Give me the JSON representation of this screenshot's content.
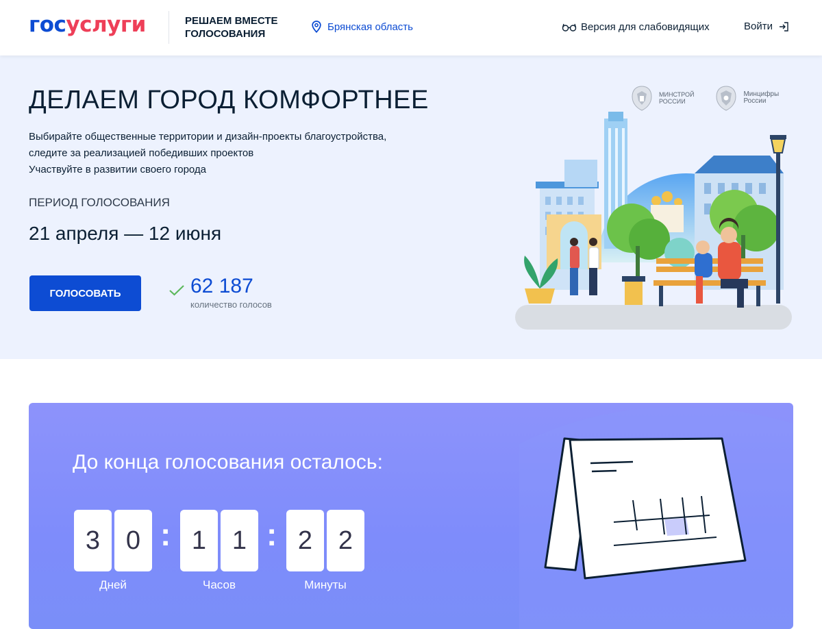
{
  "header": {
    "logo_part1": "гос",
    "logo_part2": "услуги",
    "tagline_line1": "РЕШАЕМ ВМЕСТЕ",
    "tagline_line2": "ГОЛОСОВАНИЯ",
    "region": "Брянская область",
    "vision_link": "Версия для слабовидящих",
    "login": "Войти"
  },
  "hero": {
    "title": "ДЕЛАЕМ ГОРОД КОМФОРТНЕЕ",
    "desc_line1": "Выбирайте общественные территории и дизайн-проекты благоустройства,",
    "desc_line2": "следите за реализацией победивших проектов",
    "desc_line3": "Участвуйте в развитии своего города",
    "period_label": "ПЕРИОД ГОЛОСОВАНИЯ",
    "period_dates": "21 апреля — 12 июня",
    "vote_button": "ГОЛОСОВАТЬ",
    "vote_count": "62 187",
    "vote_count_label": "количество голосов",
    "ministry1_line1": "МИНСТРОЙ",
    "ministry1_line2": "РОССИИ",
    "ministry2_line1": "Минцифры",
    "ministry2_line2": "России"
  },
  "countdown": {
    "title": "До конца голосования осталось:",
    "days_digits": [
      "3",
      "0"
    ],
    "hours_digits": [
      "1",
      "1"
    ],
    "minutes_digits": [
      "2",
      "2"
    ],
    "separator": ":",
    "days_label": "Дней",
    "hours_label": "Часов",
    "minutes_label": "Минуты"
  },
  "colors": {
    "brand_blue": "#0d4cd3",
    "brand_red": "#ee3f58",
    "hero_bg": "#edf2fe",
    "countdown_bg": "#8d93fb",
    "check_green": "#5cb85c"
  },
  "icons": [
    "location-pin-icon",
    "glasses-icon",
    "login-arrow-icon",
    "check-icon",
    "coat-of-arms-icon",
    "calendar-illustration-icon"
  ]
}
